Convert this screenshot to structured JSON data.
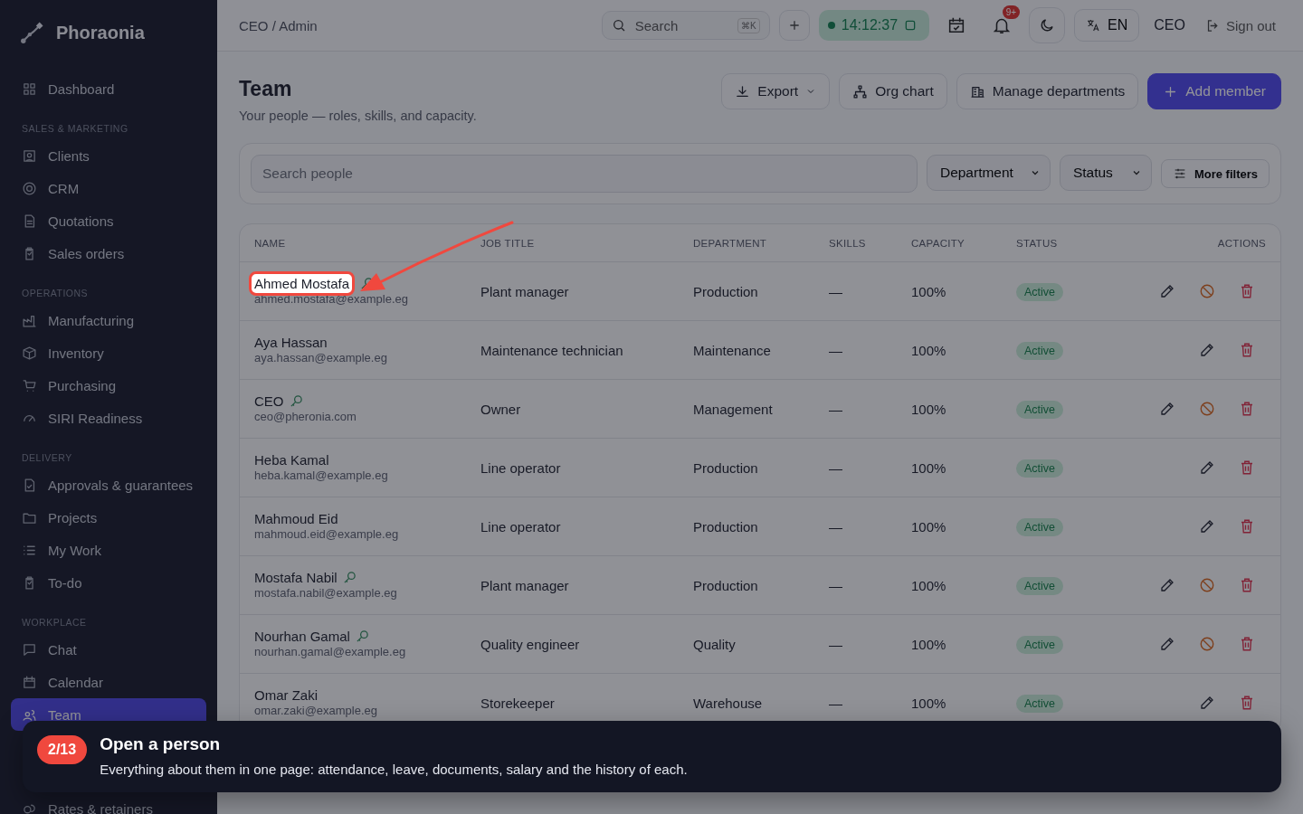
{
  "sidebar": {
    "brand": "Phoraonia",
    "sections": [
      {
        "items": [
          {
            "label": "Dashboard",
            "selected": false
          }
        ]
      },
      {
        "title": "SALES & MARKETING",
        "items": [
          {
            "label": "Clients",
            "selected": false
          },
          {
            "label": "CRM",
            "selected": false
          },
          {
            "label": "Quotations",
            "selected": false
          },
          {
            "label": "Sales orders",
            "selected": false
          }
        ]
      },
      {
        "title": "OPERATIONS",
        "items": [
          {
            "label": "Manufacturing",
            "selected": false
          },
          {
            "label": "Inventory",
            "selected": false
          },
          {
            "label": "Purchasing",
            "selected": false
          },
          {
            "label": "SIRI Readiness",
            "selected": false
          }
        ]
      },
      {
        "title": "DELIVERY",
        "items": [
          {
            "label": "Approvals & guarantees",
            "selected": false
          },
          {
            "label": "Projects",
            "selected": false
          },
          {
            "label": "My Work",
            "selected": false
          },
          {
            "label": "To-do",
            "selected": false
          }
        ]
      },
      {
        "title": "WORKPLACE",
        "items": [
          {
            "label": "Chat",
            "selected": false
          },
          {
            "label": "Calendar",
            "selected": false
          },
          {
            "label": "Team",
            "selected": true
          }
        ]
      },
      {
        "items": [
          {
            "label": "Rates & retainers",
            "selected": false
          }
        ]
      }
    ]
  },
  "topbar": {
    "breadcrumb": "CEO / Admin",
    "search": {
      "placeholder": "Search",
      "shortcut": "⌘K"
    },
    "timer": {
      "time": "14:12:37",
      "running": true
    },
    "notifications_badge": "9+",
    "language": "EN",
    "user": "CEO",
    "sign_out": "Sign out"
  },
  "header": {
    "title": "Team",
    "subtitle": "Your people — roles, skills, and capacity.",
    "buttons": [
      {
        "label": "Export",
        "kind": "export"
      },
      {
        "label": "Org chart",
        "kind": "org"
      },
      {
        "label": "Manage departments",
        "kind": "departments"
      },
      {
        "label": "Add member",
        "kind": "primary"
      }
    ]
  },
  "filters": {
    "search_placeholder": "Search people",
    "selects": [
      "Department",
      "Status"
    ],
    "more": "More filters"
  },
  "table": {
    "columns": [
      "NAME",
      "JOB TITLE",
      "DEPARTMENT",
      "SKILLS",
      "CAPACITY",
      "STATUS",
      "ACTIONS"
    ],
    "rows": [
      {
        "name": "Ahmed Mostafa",
        "email": "ahmed.mostafa@example.eg",
        "title": "Plant manager",
        "department": "Production",
        "skills": "—",
        "capacity": "100%",
        "status": "Active",
        "key_access": true,
        "spotlight": true,
        "can_deactivate": true
      },
      {
        "name": "Aya Hassan",
        "email": "aya.hassan@example.eg",
        "title": "Maintenance technician",
        "department": "Maintenance",
        "skills": "—",
        "capacity": "100%",
        "status": "Active",
        "key_access": false,
        "spotlight": false,
        "can_deactivate": false
      },
      {
        "name": "CEO",
        "email": "ceo@pheronia.com",
        "title": "Owner",
        "department": "Management",
        "skills": "—",
        "capacity": "100%",
        "status": "Active",
        "key_access": true,
        "spotlight": false,
        "can_deactivate": true
      },
      {
        "name": "Heba Kamal",
        "email": "heba.kamal@example.eg",
        "title": "Line operator",
        "department": "Production",
        "skills": "—",
        "capacity": "100%",
        "status": "Active",
        "key_access": false,
        "spotlight": false,
        "can_deactivate": false
      },
      {
        "name": "Mahmoud Eid",
        "email": "mahmoud.eid@example.eg",
        "title": "Line operator",
        "department": "Production",
        "skills": "—",
        "capacity": "100%",
        "status": "Active",
        "key_access": false,
        "spotlight": false,
        "can_deactivate": false
      },
      {
        "name": "Mostafa Nabil",
        "email": "mostafa.nabil@example.eg",
        "title": "Plant manager",
        "department": "Production",
        "skills": "—",
        "capacity": "100%",
        "status": "Active",
        "key_access": true,
        "spotlight": false,
        "can_deactivate": true
      },
      {
        "name": "Nourhan Gamal",
        "email": "nourhan.gamal@example.eg",
        "title": "Quality engineer",
        "department": "Quality",
        "skills": "—",
        "capacity": "100%",
        "status": "Active",
        "key_access": true,
        "spotlight": false,
        "can_deactivate": true
      },
      {
        "name": "Omar Zaki",
        "email": "omar.zaki@example.eg",
        "title": "Storekeeper",
        "department": "Warehouse",
        "skills": "—",
        "capacity": "100%",
        "status": "Active",
        "key_access": false,
        "spotlight": false,
        "can_deactivate": false
      }
    ]
  },
  "tour": {
    "step": "2/13",
    "title": "Open a person",
    "text": "Everything about them in one page: attendance, leave, documents, salary and the history of each."
  }
}
